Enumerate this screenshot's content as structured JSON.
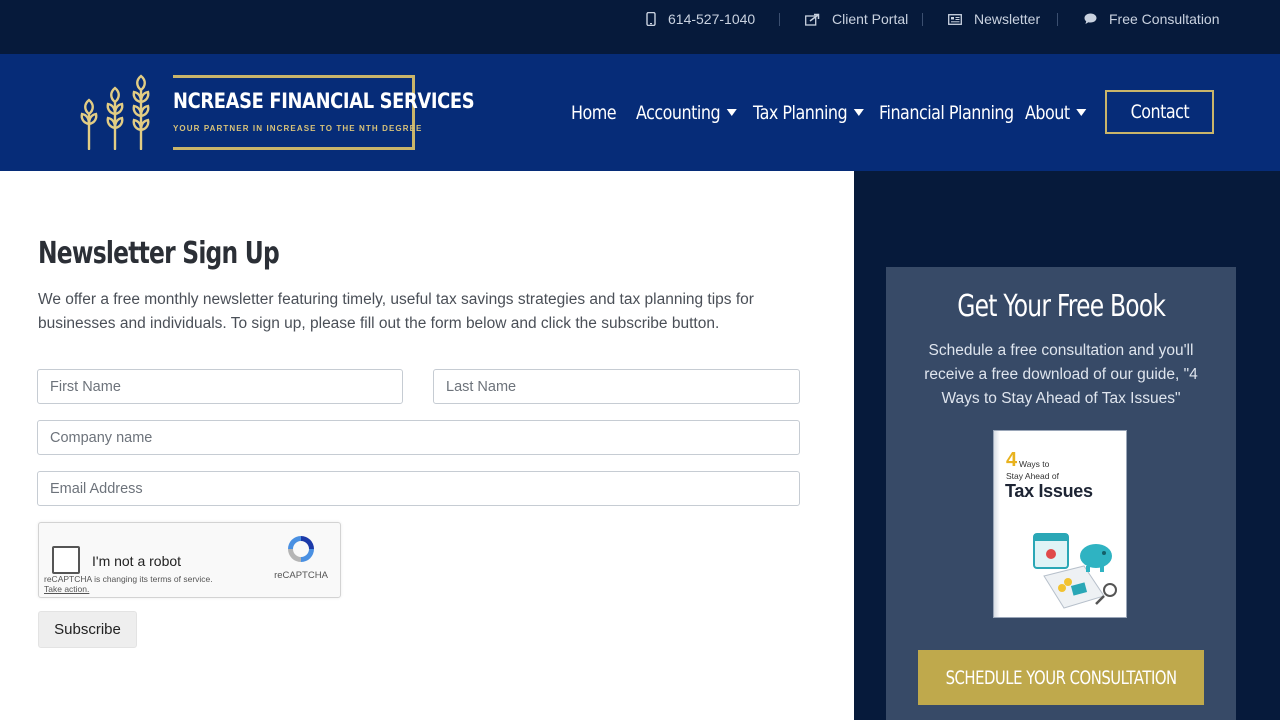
{
  "topbar": {
    "phone": "614-527-1040",
    "client_portal": "Client Portal",
    "newsletter": "Newsletter",
    "free_consultation": "Free Consultation"
  },
  "logo": {
    "title": "NCREASE FINANCIAL SERVICES",
    "tagline": "YOUR PARTNER IN INCREASE TO THE NTH DEGREE"
  },
  "nav": {
    "items": [
      "Home",
      "Accounting",
      "Tax Planning",
      "Financial Planning",
      "About"
    ],
    "contact": "Contact"
  },
  "main": {
    "title": "Newsletter Sign Up",
    "intro": "We offer a free monthly newsletter featuring timely, useful tax savings strategies and tax planning tips for businesses and individuals. To sign up, please fill out the form below and click the subscribe button.",
    "first_name_placeholder": "First Name",
    "last_name_placeholder": "Last Name",
    "company_placeholder": "Company name",
    "email_placeholder": "Email Address",
    "captcha_label": "I'm not a robot",
    "captcha_note": "reCAPTCHA is changing its terms of service.",
    "captcha_action": "Take action.",
    "captcha_brand": "reCAPTCHA",
    "subscribe": "Subscribe"
  },
  "sidebar": {
    "title": "Get Your Free Book",
    "text": "Schedule a free consultation and you'll receive a free download of our guide, \"4 Ways to Stay Ahead of Tax Issues\"",
    "book_number": "4",
    "book_line1": "Ways to",
    "book_line2": "Stay Ahead of",
    "book_line3": "Tax Issues",
    "cta": "SCHEDULE YOUR CONSULTATION"
  },
  "colors": {
    "topbar": "#061a3b",
    "header": "#062c78",
    "gold": "#c9b56a",
    "cta": "#bfa94c",
    "card": "#374a67"
  }
}
